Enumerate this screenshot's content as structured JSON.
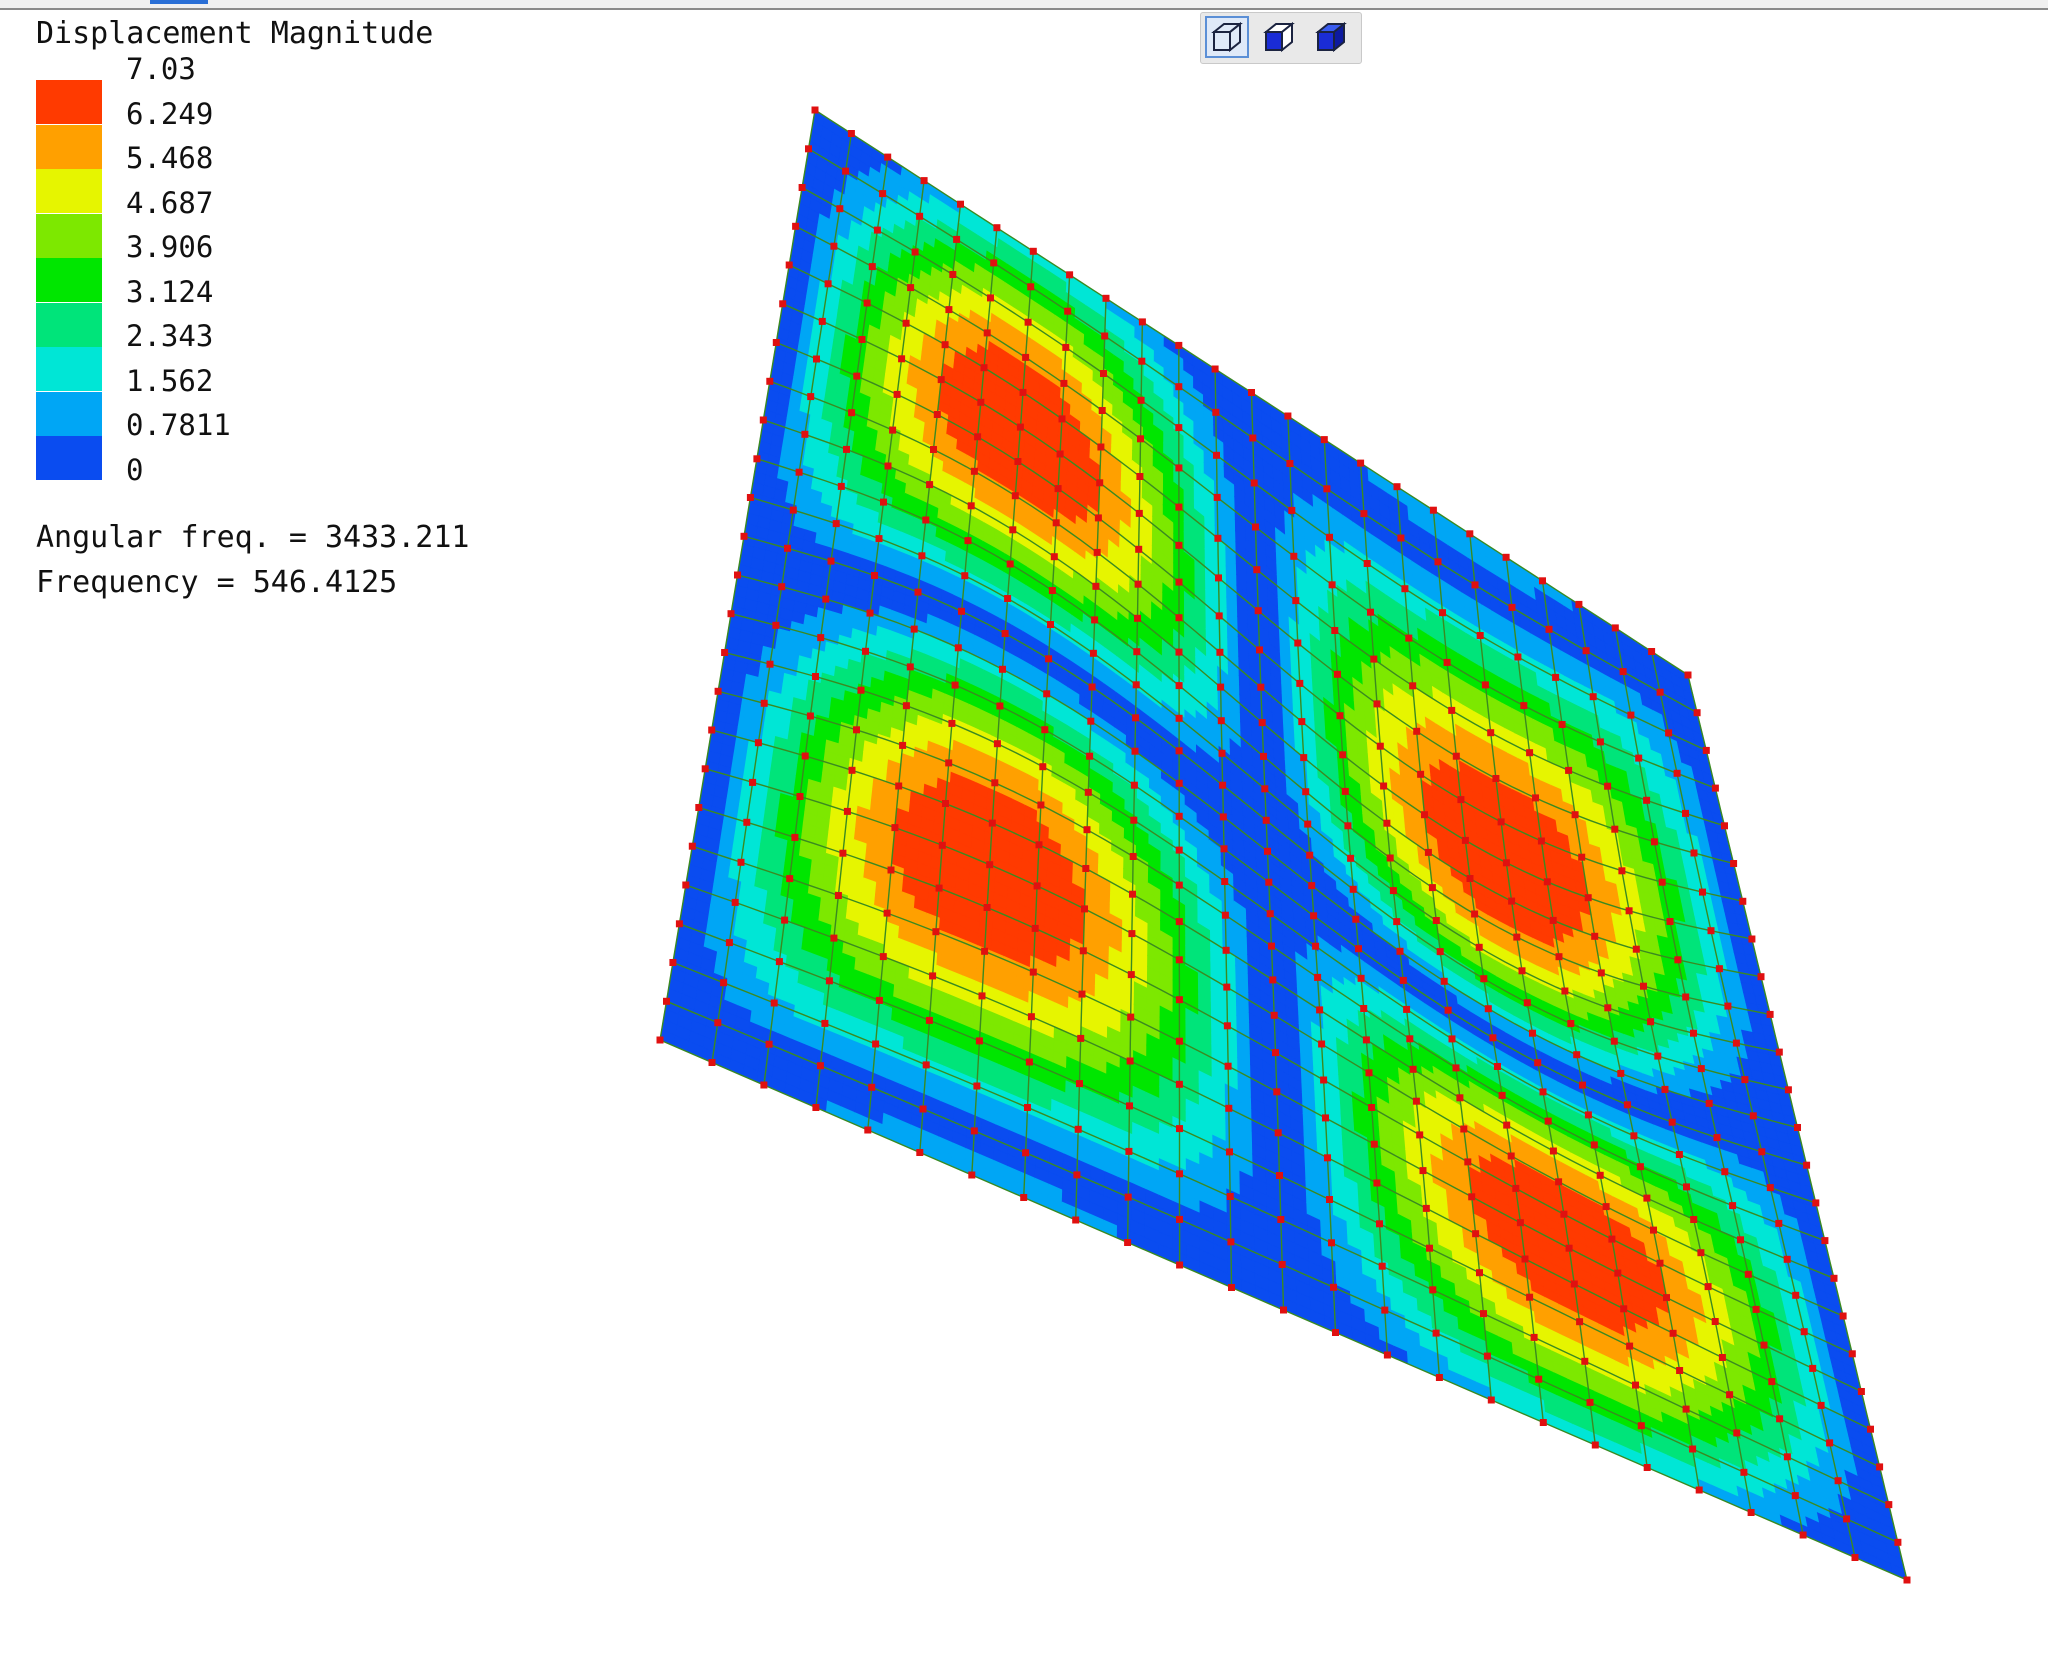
{
  "legend": {
    "title": "Displacement Magnitude",
    "ticks": [
      "7.03",
      "6.249",
      "5.468",
      "4.687",
      "3.906",
      "3.124",
      "2.343",
      "1.562",
      "0.7811",
      "0"
    ],
    "colors": [
      "#ff3a00",
      "#ffa000",
      "#e6f500",
      "#7de800",
      "#00e600",
      "#00e47a",
      "#00e6d6",
      "#00a6f5",
      "#0a4cf0"
    ]
  },
  "info": {
    "angular": "Angular freq. = 3433.211",
    "frequency": "Frequency = 546.4125"
  },
  "toolbar": {
    "buttons": [
      "wireframe-cube-icon",
      "shaded-cube-icon",
      "solid-cube-icon"
    ],
    "active": "wireframe-cube-icon",
    "accent": "#1a2cd6"
  },
  "mesh": {
    "node_color": "#e01010",
    "line_color": "#3a8a20"
  }
}
